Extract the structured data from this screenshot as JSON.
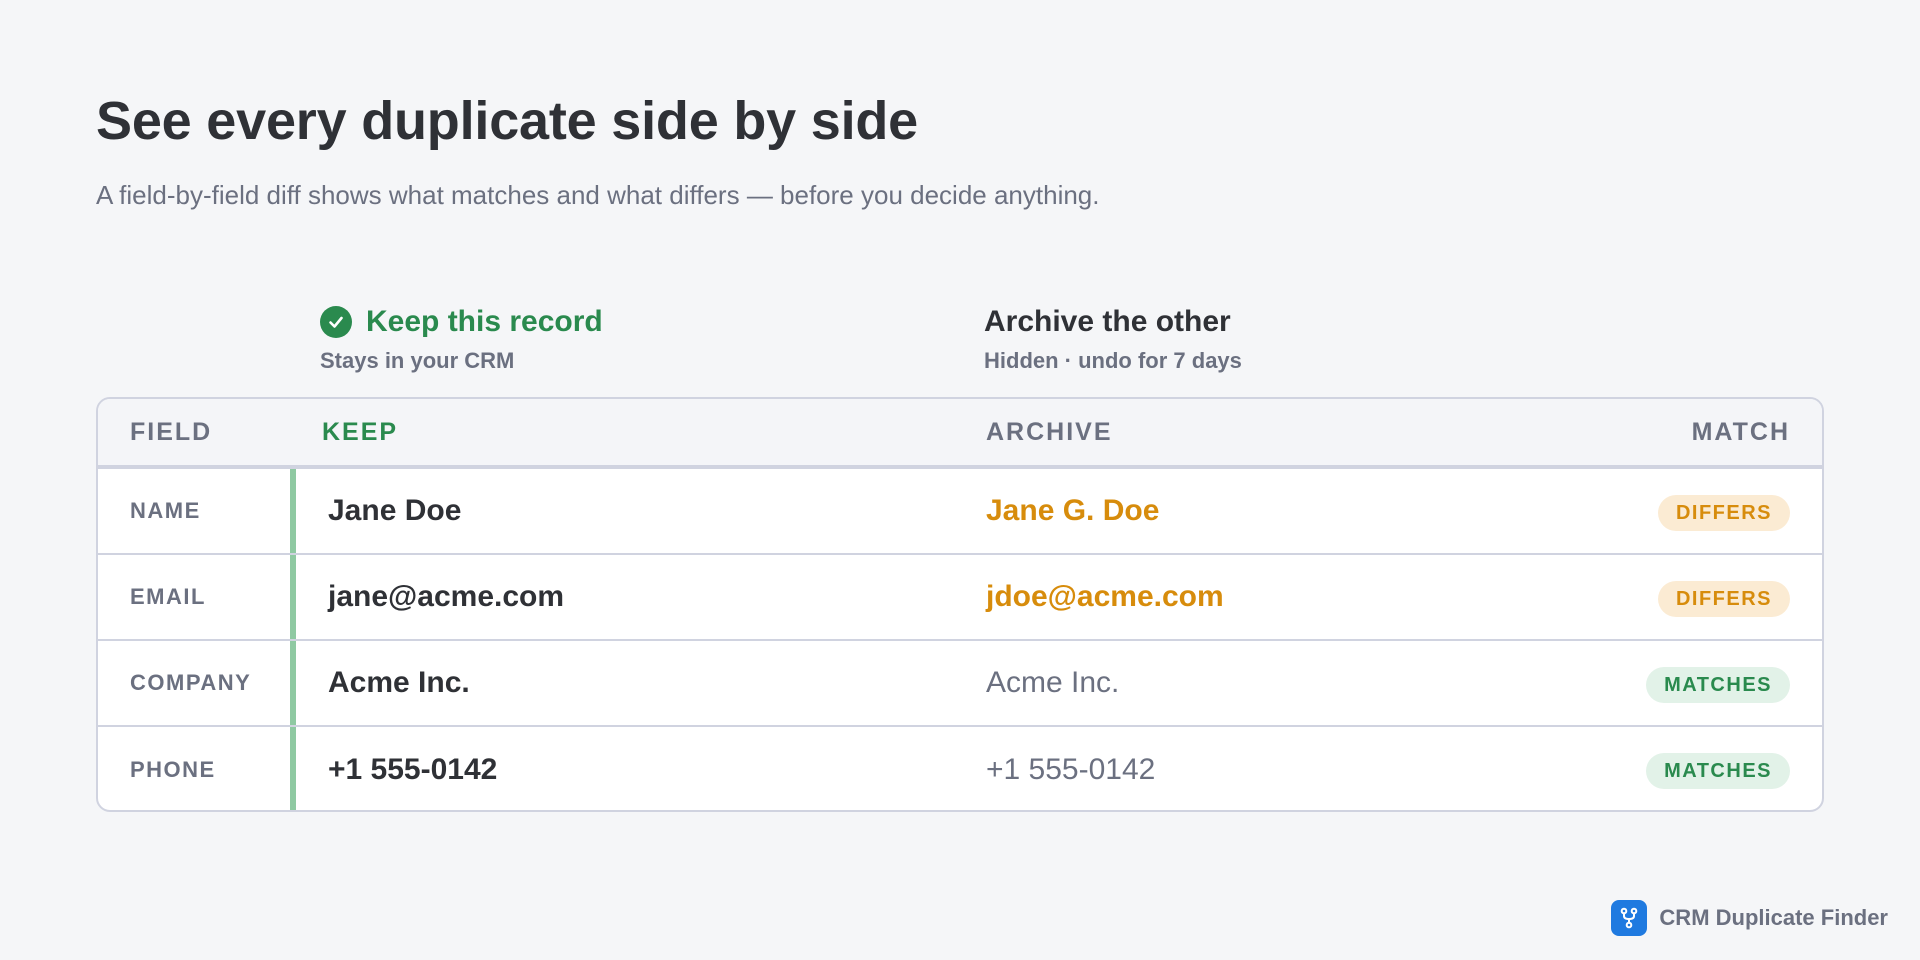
{
  "header": {
    "title": "See every duplicate side by side",
    "subtitle": "A field-by-field diff shows what matches and what differs — before you decide anything."
  },
  "columns": {
    "keep": {
      "title": "Keep this record",
      "subtitle": "Stays in your CRM",
      "icon": "check-circle-icon"
    },
    "archive": {
      "title": "Archive the other",
      "subtitle": "Hidden · undo for 7 days"
    }
  },
  "table": {
    "headers": {
      "field": "FIELD",
      "keep": "KEEP",
      "archive": "ARCHIVE",
      "match": "MATCH"
    },
    "rows": [
      {
        "field": "NAME",
        "keep": "Jane Doe",
        "archive": "Jane G. Doe",
        "status": "differs",
        "badge": "DIFFERS"
      },
      {
        "field": "EMAIL",
        "keep": "jane@acme.com",
        "archive": "jdoe@acme.com",
        "status": "differs",
        "badge": "DIFFERS"
      },
      {
        "field": "COMPANY",
        "keep": "Acme Inc.",
        "archive": "Acme Inc.",
        "status": "matches",
        "badge": "MATCHES"
      },
      {
        "field": "PHONE",
        "keep": "+1 555-0142",
        "archive": "+1 555-0142",
        "status": "matches",
        "badge": "MATCHES"
      }
    ]
  },
  "brand": {
    "name": "CRM Duplicate Finder",
    "icon": "merge-branch-icon"
  },
  "colors": {
    "keep_green": "#2a8a4e",
    "differs_amber": "#d78c0c",
    "brand_blue": "#1f7ae0"
  }
}
